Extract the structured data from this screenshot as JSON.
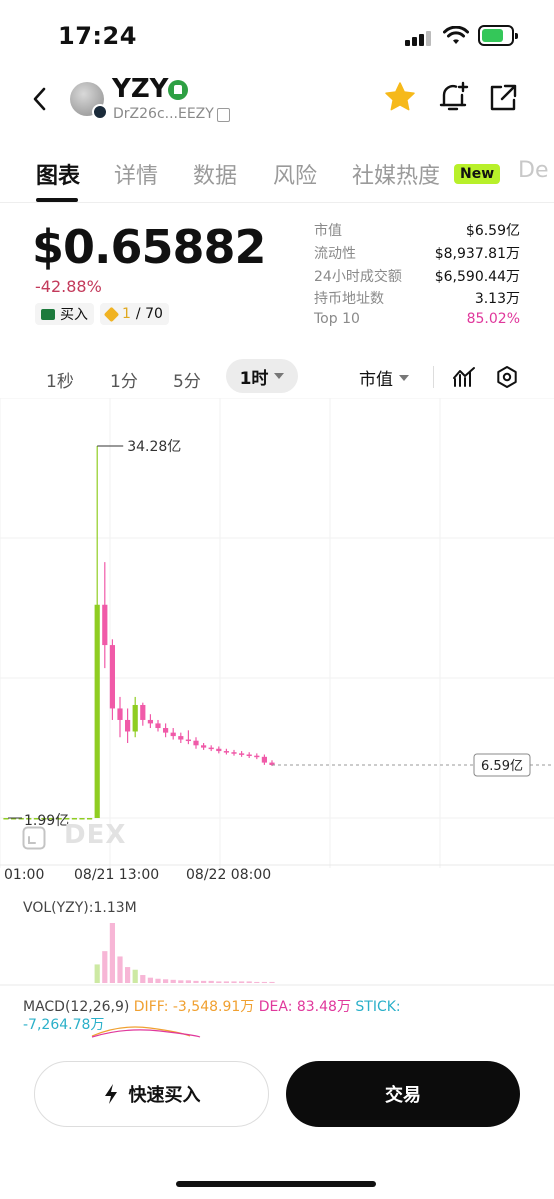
{
  "status_bar": {
    "time": "17:24",
    "icons": [
      "cellular-signal-icon",
      "wifi-icon",
      "battery-charging-icon"
    ]
  },
  "header": {
    "token_name": "YZY",
    "address": "DrZ26c...EEZY",
    "icons": [
      "back-icon",
      "verified-icon",
      "copy-icon",
      "star-icon",
      "bell-plus-icon",
      "share-icon"
    ],
    "star_color": "#f6b91a"
  },
  "tabs": {
    "items": [
      "图表",
      "详情",
      "数据",
      "风险",
      "社媒热度",
      "De"
    ],
    "active": "图表",
    "new_badge": "New"
  },
  "price": {
    "value": "$0.65882",
    "change": "-42.88%",
    "buy_chip": "买入",
    "rank_current": "1",
    "rank_total": "/ 70",
    "change_color": "#c33a5b"
  },
  "stats": [
    {
      "key": "市值",
      "value": "$6.59亿"
    },
    {
      "key": "流动性",
      "value": "$8,937.81万"
    },
    {
      "key": "24小时成交额",
      "value": "$6,590.44万"
    },
    {
      "key": "持币地址数",
      "value": "3.13万"
    },
    {
      "key": "Top 10",
      "value": "85.02%"
    }
  ],
  "timeframes": {
    "items": [
      "1秒",
      "1分",
      "5分"
    ],
    "active": "1时",
    "metric": "市值"
  },
  "chart": {
    "watermark": "DEX",
    "high_label": "34.28亿",
    "low_label": "1.99亿",
    "current_label": "6.59亿",
    "x_labels": [
      "01:00",
      "08/21 13:00",
      "08/22 08:00"
    ],
    "vol_label": "VOL(YZY):1.13M",
    "macd": {
      "name": "MACD(12,26,9)",
      "diff": "DIFF: -3,548.91万",
      "dea": "DEA: 83.48万",
      "stick": "STICK:",
      "stick_value": "-7,264.78万"
    },
    "colors": {
      "up": "#8fcd22",
      "down": "#f05aa8"
    }
  },
  "chart_data": {
    "type": "candlestick",
    "title": "",
    "ylabel": "市值",
    "x_ticks": [
      "01:00",
      "08/21 13:00",
      "08/22 08:00"
    ],
    "high": 3428000000,
    "low": 199000000,
    "last": 659000000,
    "candles_in_yi": [
      [
        1.99,
        1.99,
        1.99,
        1.99
      ],
      [
        1.99,
        1.99,
        1.99,
        1.99
      ],
      [
        1.99,
        1.99,
        1.99,
        1.99
      ],
      [
        1.99,
        1.99,
        1.99,
        1.99
      ],
      [
        1.99,
        1.99,
        1.99,
        1.99
      ],
      [
        1.99,
        1.99,
        1.99,
        1.99
      ],
      [
        1.99,
        1.99,
        1.99,
        1.99
      ],
      [
        1.99,
        1.99,
        1.99,
        1.99
      ],
      [
        1.99,
        1.99,
        1.99,
        1.99
      ],
      [
        1.99,
        1.99,
        1.99,
        1.99
      ],
      [
        1.99,
        1.99,
        1.99,
        1.99
      ],
      [
        1.99,
        1.99,
        1.99,
        1.99
      ],
      [
        1.99,
        34.28,
        1.99,
        20.5
      ],
      [
        20.5,
        24.2,
        15.0,
        17.0
      ],
      [
        17.0,
        17.5,
        10.5,
        11.5
      ],
      [
        11.5,
        12.5,
        9.0,
        10.5
      ],
      [
        10.5,
        11.5,
        8.5,
        9.5
      ],
      [
        9.5,
        12.5,
        9.0,
        11.8
      ],
      [
        11.8,
        12.0,
        10.0,
        10.5
      ],
      [
        10.5,
        11.0,
        9.8,
        10.2
      ],
      [
        10.2,
        10.5,
        9.5,
        9.8
      ],
      [
        9.8,
        10.2,
        9.0,
        9.4
      ],
      [
        9.4,
        9.8,
        8.8,
        9.1
      ],
      [
        9.1,
        9.4,
        8.5,
        8.8
      ],
      [
        8.8,
        9.6,
        8.4,
        8.7
      ],
      [
        8.7,
        9.0,
        8.0,
        8.3
      ],
      [
        8.3,
        8.5,
        7.9,
        8.1
      ],
      [
        8.1,
        8.3,
        7.8,
        8.0
      ],
      [
        8.0,
        8.2,
        7.6,
        7.8
      ],
      [
        7.8,
        8.0,
        7.5,
        7.7
      ],
      [
        7.7,
        7.9,
        7.4,
        7.6
      ],
      [
        7.6,
        7.8,
        7.3,
        7.5
      ],
      [
        7.5,
        7.7,
        7.2,
        7.4
      ],
      [
        7.4,
        7.6,
        7.1,
        7.3
      ],
      [
        7.3,
        7.5,
        6.6,
        6.8
      ],
      [
        6.8,
        7.0,
        6.5,
        6.59
      ]
    ],
    "volume": [
      0,
      0,
      0,
      0,
      0,
      0,
      0,
      0,
      0,
      0,
      0,
      0,
      0.35,
      0.6,
      1.13,
      0.5,
      0.3,
      0.25,
      0.15,
      0.1,
      0.08,
      0.07,
      0.06,
      0.05,
      0.05,
      0.04,
      0.04,
      0.04,
      0.03,
      0.03,
      0.03,
      0.03,
      0.03,
      0.02,
      0.02,
      0.02
    ],
    "y_scale": "linear"
  }
}
